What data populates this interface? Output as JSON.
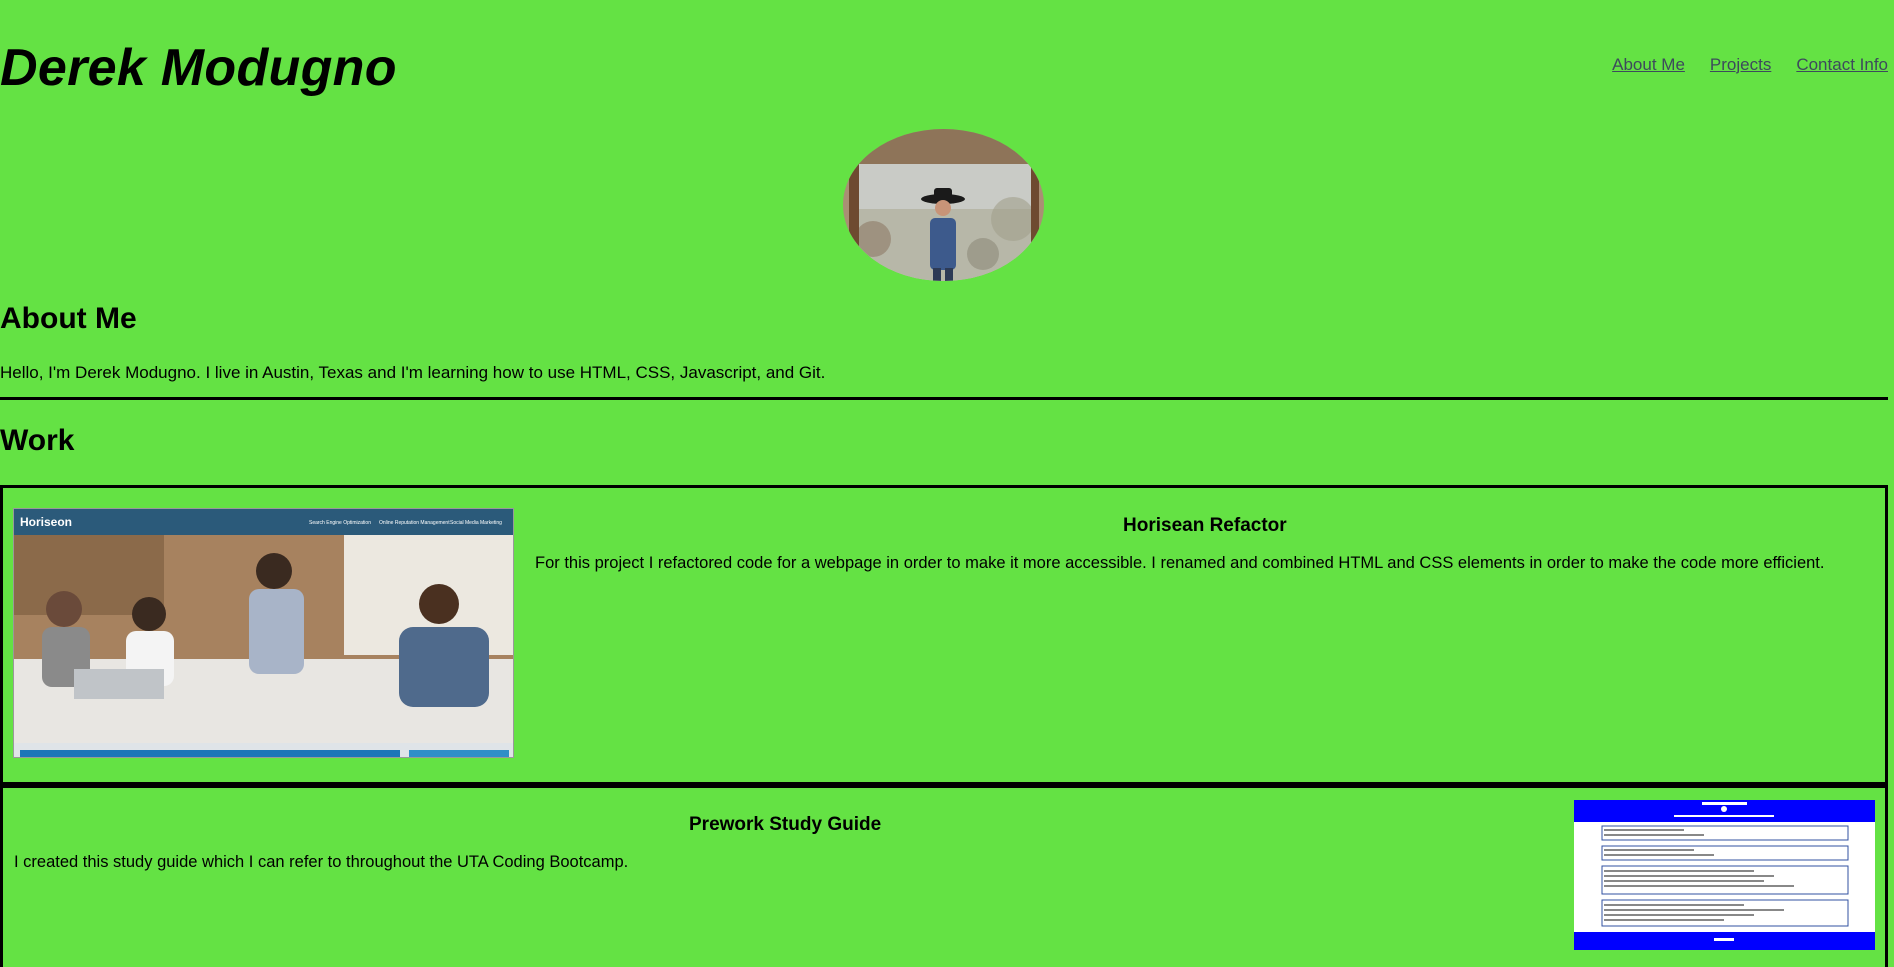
{
  "header": {
    "title": "Derek Modugno",
    "nav": [
      "About Me",
      "Projects",
      "Contact Info"
    ]
  },
  "about": {
    "heading": "About Me",
    "text": "Hello, I'm Derek Modugno. I live in Austin, Texas and I'm learning how to use HTML, CSS, Javascript, and Git."
  },
  "work": {
    "heading": "Work",
    "projects": [
      {
        "title": "Horisean Refactor",
        "description": "For this project I refactored code for a webpage in order to make it more accessible. I renamed and combined HTML and CSS elements in order to make the code more efficient.",
        "thumbnail": {
          "brand": "Horiseon",
          "nav": [
            "Search Engine Optimization",
            "Online Reputation Management",
            "Social Media Marketing"
          ]
        }
      },
      {
        "title": "Prework Study Guide",
        "description": "I created this study guide which I can refer to throughout the UTA Coding Bootcamp."
      }
    ]
  },
  "colors": {
    "background": "#64e244",
    "link": "#3d4a5c",
    "border": "#000000",
    "study_guide_blue": "#0000ff"
  }
}
